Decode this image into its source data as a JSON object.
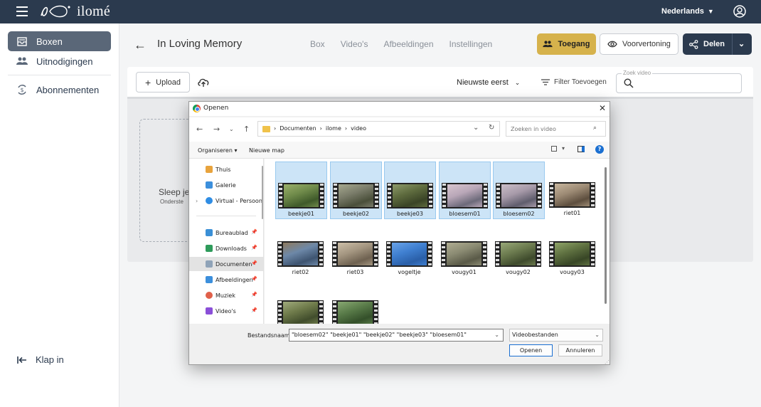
{
  "topbar": {
    "brand": "ilomé",
    "language": "Nederlands"
  },
  "sidebar": {
    "items": [
      {
        "label": "Boxen",
        "icon": "inbox-icon",
        "active": true
      },
      {
        "label": "Uitnodigingen",
        "icon": "people-icon",
        "active": false
      },
      {
        "label": "Abonnementen",
        "icon": "subscription-icon",
        "active": false
      }
    ],
    "collapse_label": "Klap in"
  },
  "header": {
    "title": "In Loving Memory",
    "tabs": [
      "Box",
      "Video's",
      "Afbeeldingen",
      "Instellingen"
    ],
    "access_label": "Toegang",
    "preview_label": "Voorvertoning",
    "share_label": "Delen"
  },
  "toolbar": {
    "upload_label": "Upload",
    "sort_label": "Nieuwste eerst",
    "filter_label": "Filter Toevoegen",
    "search_legend": "Zoek video"
  },
  "dropzone": {
    "title": "Sleep je",
    "subtitle": "Onderste"
  },
  "dialog": {
    "title": "Openen",
    "breadcrumb": [
      "Documenten",
      "ilome",
      "video"
    ],
    "search_placeholder": "Zoeken in video",
    "organize_label": "Organiseren",
    "new_folder_label": "Nieuwe map",
    "tree": [
      {
        "label": "Thuis",
        "icon": "home-icon",
        "color": "#e8a33d"
      },
      {
        "label": "Galerie",
        "icon": "gallery-icon",
        "color": "#3c8fdc"
      },
      {
        "label": "Virtual - Persoonlijk",
        "icon": "cloud-icon",
        "color": "#2f8de4"
      },
      {
        "label": "Bureaublad",
        "icon": "desktop-icon",
        "color": "#3a8fd6"
      },
      {
        "label": "Downloads",
        "icon": "download-icon",
        "color": "#2e9b5b"
      },
      {
        "label": "Documenten",
        "icon": "document-icon",
        "color": "#8fa3b8"
      },
      {
        "label": "Afbeeldingen",
        "icon": "pictures-icon",
        "color": "#3c8fdc"
      },
      {
        "label": "Muziek",
        "icon": "music-icon",
        "color": "#e0604a"
      },
      {
        "label": "Video's",
        "icon": "video-icon",
        "color": "#8a4fd8"
      }
    ],
    "files": [
      {
        "name": "beekje01",
        "selected": true,
        "tint": [
          "#6f8a4a",
          "#3f5a2a",
          "#9bb06a"
        ]
      },
      {
        "name": "beekje02",
        "selected": true,
        "tint": [
          "#7a7c6a",
          "#4a4f3a",
          "#a6a98f"
        ]
      },
      {
        "name": "beekje03",
        "selected": true,
        "tint": [
          "#5e6b3e",
          "#3a4426",
          "#8d9a6a"
        ]
      },
      {
        "name": "bloesem01",
        "selected": true,
        "tint": [
          "#b9a7b8",
          "#6c6a7a",
          "#d8c5cf"
        ]
      },
      {
        "name": "bloesem02",
        "selected": true,
        "tint": [
          "#a79aa9",
          "#5f5d6d",
          "#cbbec8"
        ]
      },
      {
        "name": "riet01",
        "selected": false,
        "tint": [
          "#9c8a74",
          "#5d4e3e",
          "#c8b69e"
        ]
      },
      {
        "name": "riet02",
        "selected": false,
        "tint": [
          "#6d88a8",
          "#3e5470",
          "#8e7a5e"
        ]
      },
      {
        "name": "riet03",
        "selected": false,
        "tint": [
          "#a39580",
          "#6e6150",
          "#cdbfa8"
        ]
      },
      {
        "name": "vogeltje",
        "selected": false,
        "tint": [
          "#3f7fd0",
          "#2a5fa8",
          "#6aa3e8"
        ]
      },
      {
        "name": "vougy01",
        "selected": false,
        "tint": [
          "#8a8a72",
          "#5a5a48",
          "#b0ad92"
        ]
      },
      {
        "name": "vougy02",
        "selected": false,
        "tint": [
          "#6b7a4e",
          "#3e4a2c",
          "#98a878"
        ]
      },
      {
        "name": "vougy03",
        "selected": false,
        "tint": [
          "#5e7040",
          "#384626",
          "#8fa468"
        ]
      },
      {
        "name": "",
        "selected": false,
        "tint": [
          "#6e7a4a",
          "#414d2c",
          "#a0ab7c"
        ]
      },
      {
        "name": "",
        "selected": false,
        "tint": [
          "#587a48",
          "#34502a",
          "#88a872"
        ]
      }
    ],
    "filename_label": "Bestandsnaam:",
    "filename_value": "\"bloesem02\" \"beekje01\" \"beekje02\" \"beekje03\" \"bloesem01\"",
    "filetype_value": "Videobestanden",
    "open_label": "Openen",
    "cancel_label": "Annuleren"
  }
}
